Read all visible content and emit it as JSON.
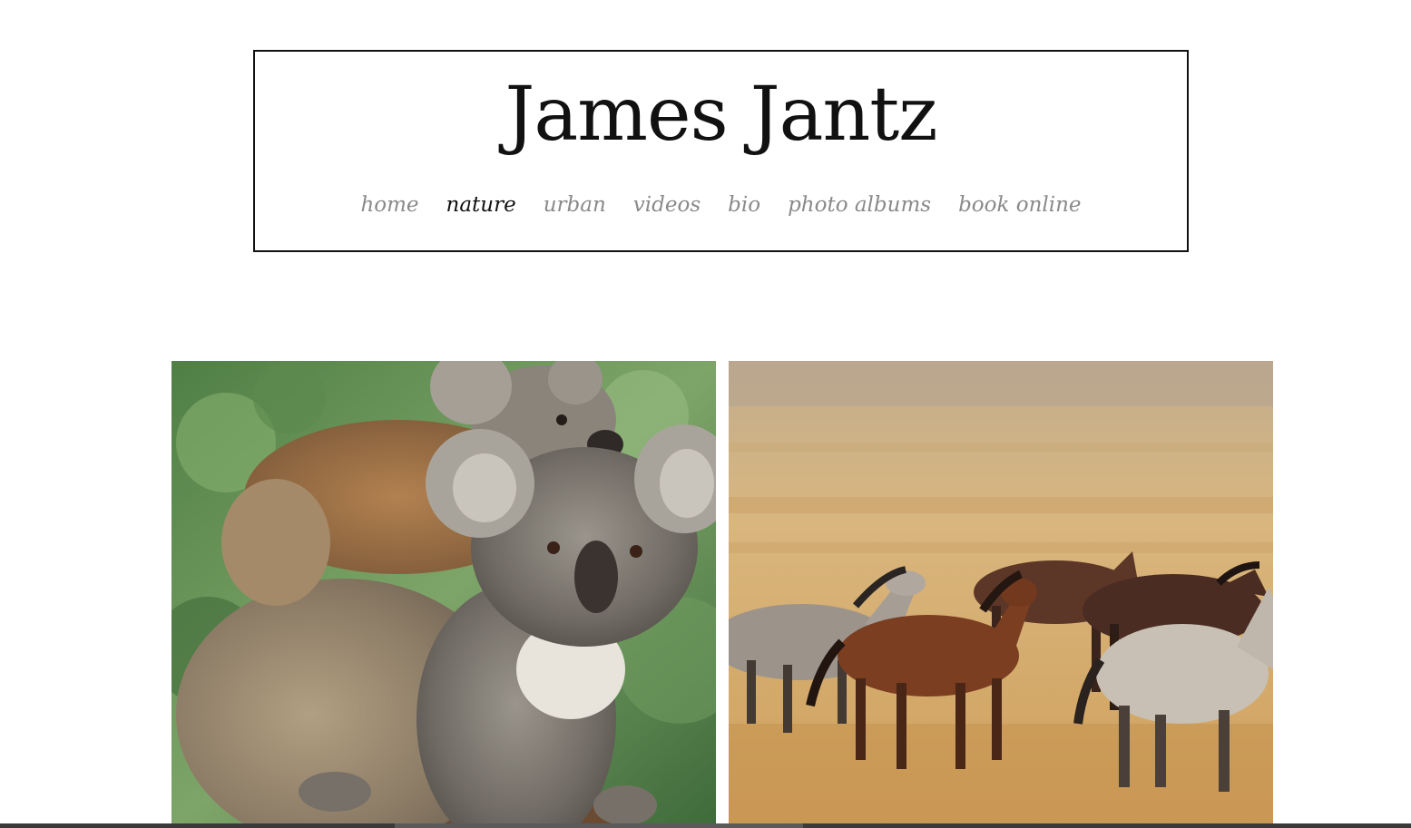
{
  "site": {
    "title": "James Jantz"
  },
  "nav": {
    "items": [
      {
        "label": "home",
        "active": false
      },
      {
        "label": "nature",
        "active": true
      },
      {
        "label": "urban",
        "active": false
      },
      {
        "label": "videos",
        "active": false
      },
      {
        "label": "bio",
        "active": false
      },
      {
        "label": "photo albums",
        "active": false
      },
      {
        "label": "book online",
        "active": false
      }
    ]
  },
  "gallery": {
    "photos": [
      {
        "subject": "koala-mother-and-joey"
      },
      {
        "subject": "wild-horses-running"
      }
    ]
  },
  "colors": {
    "nav_inactive": "#8a8a8a",
    "nav_active": "#111111",
    "header_border": "#111111"
  }
}
